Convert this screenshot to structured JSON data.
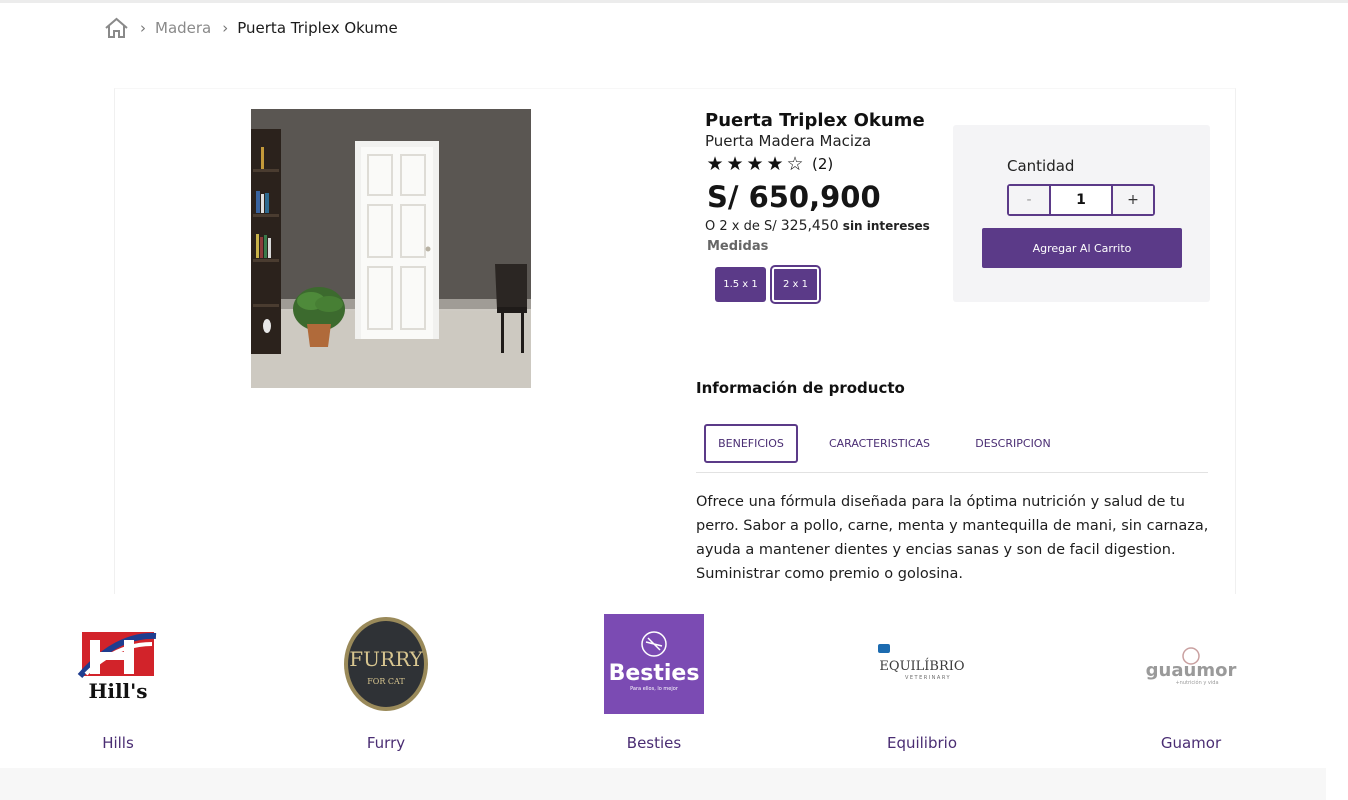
{
  "breadcrumb": {
    "home_icon": "home-icon",
    "items": [
      "Madera",
      "Puerta Triplex Okume"
    ]
  },
  "product": {
    "title": "Puerta Triplex Okume",
    "subtitle": "Puerta Madera Maciza",
    "rating": 4,
    "rating_max": 5,
    "rating_count": "(2)",
    "price": "S/ 650,900",
    "installments_prefix": "O 2 x de S/",
    "installments_amount": "325,450",
    "installments_suffix": "sin intereses",
    "medidas_label": "Medidas",
    "sizes": [
      "1.5 x 1",
      "2 x 1"
    ],
    "selected_size": "2 x 1"
  },
  "cart": {
    "quantity_label": "Cantidad",
    "minus_label": "-",
    "quantity_value": "1",
    "plus_label": "+",
    "add_button": "Agregar Al Carrito"
  },
  "info": {
    "title": "Información de producto",
    "tabs": [
      "BENEFICIOS",
      "CARACTERISTICAS",
      "DESCRIPCION"
    ],
    "active_tab": "BENEFICIOS",
    "body": "Ofrece una fórmula diseñada para la óptima nutrición y salud de tu perro. Sabor a pollo, carne, menta y mantequilla de mani, sin carnaza, ayuda a mantener dientes y encias sanas y son de facil digestion. Suministrar como premio o golosina."
  },
  "brands": [
    {
      "name": "Hills",
      "logo_text": "Hill's"
    },
    {
      "name": "Furry",
      "logo_text": "FURRY",
      "logo_sub": "FOR CAT"
    },
    {
      "name": "Besties",
      "logo_text": "Besties",
      "logo_sub": "Para ellos, lo mejor"
    },
    {
      "name": "Equilibrio",
      "logo_text": "EQUILÍBRIO",
      "logo_sub": "VETERINARY"
    },
    {
      "name": "Guamor",
      "logo_text": "guaumor",
      "logo_sub": "+nutrición y vida"
    }
  ],
  "colors": {
    "accent": "#5b3a88",
    "accent_text": "#4a2d73",
    "panel": "#f4f4f6"
  }
}
